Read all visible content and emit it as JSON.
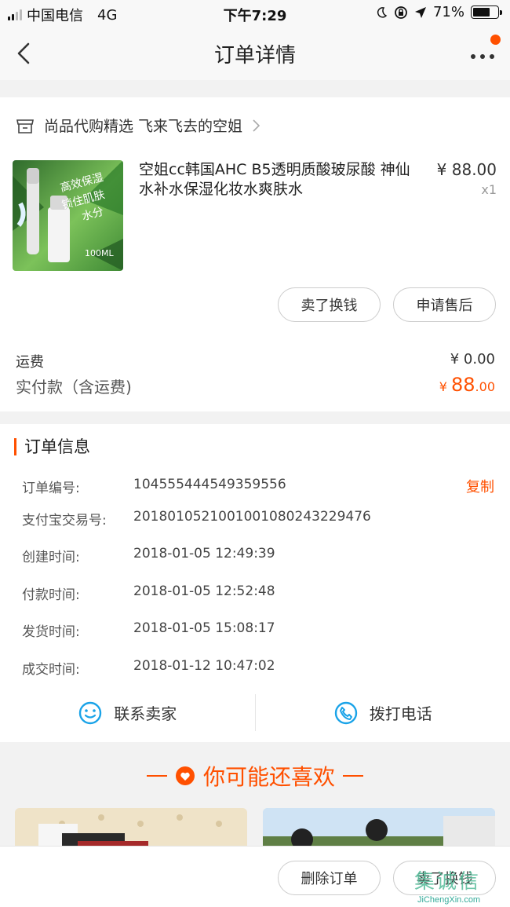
{
  "status_bar": {
    "carrier": "中国电信",
    "network": "4G",
    "time": "下午7:29",
    "battery": "71%",
    "battery_level": 0.71
  },
  "navbar": {
    "title": "订单详情"
  },
  "shop": {
    "name": "尚品代购精选 飞来飞去的空姐"
  },
  "product": {
    "title": "空姐cc韩国AHC B5透明质酸玻尿酸 神仙水补水保湿化妆水爽肤水",
    "price": "¥ 88.00",
    "quantity": "x1",
    "image_text_1": "高效保湿",
    "image_text_2": "锁住肌肤",
    "image_text_3": "水分",
    "image_text_4": "100ML"
  },
  "actions": {
    "sell_label": "卖了换钱",
    "aftersale_label": "申请售后"
  },
  "summary": {
    "shipping_label": "运费",
    "shipping_value": "¥ 0.00",
    "paid_label": "实付款（含运费)",
    "paid_currency": "¥ ",
    "paid_integer": "88",
    "paid_decimal": ".00"
  },
  "order_info": {
    "title": "订单信息",
    "copy_label": "复制",
    "rows": [
      {
        "label": "订单编号:",
        "value": "104555444549359556"
      },
      {
        "label": "支付宝交易号:",
        "value": "2018010521001001080243229476"
      },
      {
        "label": "创建时间:",
        "value": "2018-01-05 12:49:39"
      },
      {
        "label": "付款时间:",
        "value": "2018-01-05 12:52:48"
      },
      {
        "label": "发货时间:",
        "value": "2018-01-05 15:08:17"
      },
      {
        "label": "成交时间:",
        "value": "2018-01-12 10:47:02"
      }
    ]
  },
  "contact": {
    "seller_label": "联系卖家",
    "phone_label": "拨打电话"
  },
  "recommend": {
    "title": "你可能还喜欢"
  },
  "bottom_bar": {
    "delete_label": "删除订单",
    "sell_label": "卖了换钱"
  },
  "watermark": {
    "text": "JiChengXin.com",
    "chars": "集诚信"
  },
  "colors": {
    "accent": "#ff5000",
    "icon_blue": "#1aa3e8"
  }
}
